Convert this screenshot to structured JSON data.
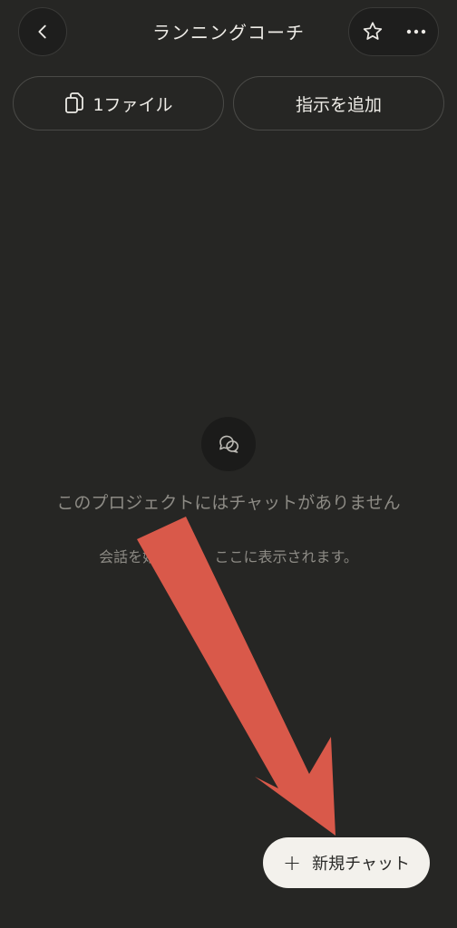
{
  "header": {
    "title": "ランニングコーチ",
    "back_icon": "chevron-left-icon",
    "star_icon": "star-outline-icon",
    "more_icon": "more-horizontal-icon"
  },
  "top_buttons": {
    "files_label": "1ファイル",
    "files_icon": "files-copy-icon",
    "instructions_label": "指示を追加"
  },
  "empty_state": {
    "icon": "chat-bubbles-icon",
    "title": "このプロジェクトにはチャットがありません",
    "subtitle": "会話を始めると、ここに表示されます。"
  },
  "new_chat": {
    "label": "新規チャット",
    "icon": "plus-icon"
  },
  "annotation": {
    "arrow_color": "#D9594A"
  },
  "colors": {
    "background": "#262624",
    "text": "#EDEBE6",
    "muted_text": "#8d8b85",
    "fab_background": "#F3F1EC"
  }
}
